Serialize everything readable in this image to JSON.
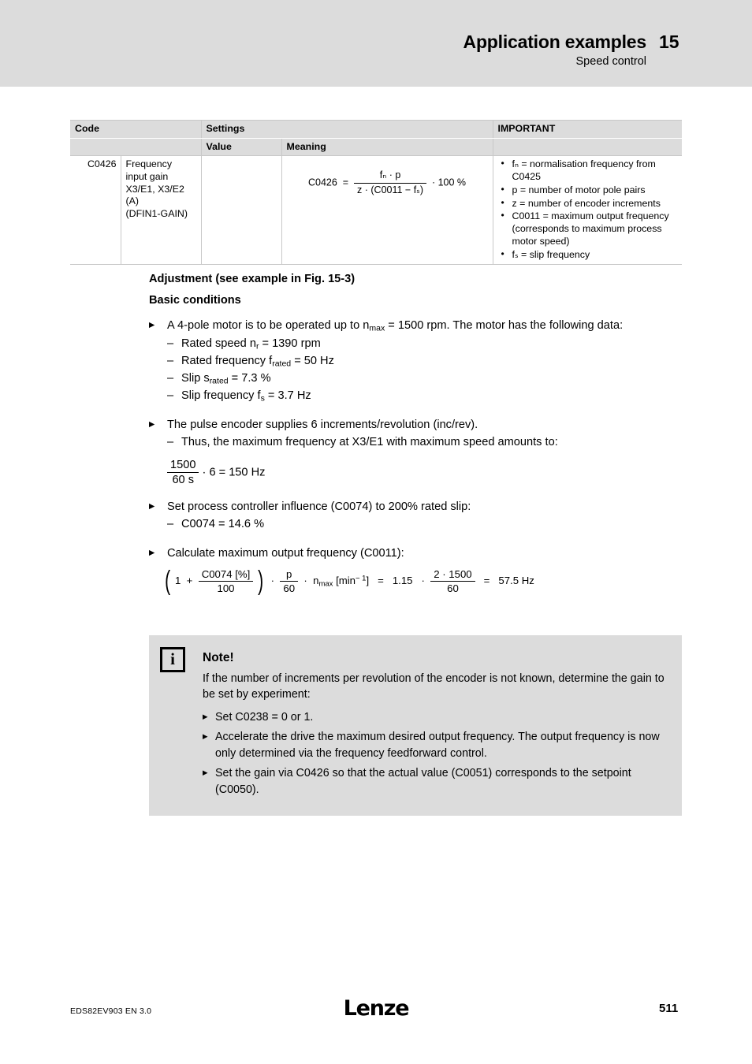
{
  "header": {
    "title": "Application examples",
    "subtitle": "Speed control",
    "chapter": "15"
  },
  "table": {
    "headers": {
      "code": "Code",
      "settings": "Settings",
      "important": "IMPORTANT",
      "value": "Value",
      "meaning": "Meaning"
    },
    "row": {
      "code": "C0426",
      "description": "Frequency input gain X3/E1, X3/E2 (A) (DFIN1-GAIN)",
      "value": "",
      "meaning_formula": {
        "lhs": "C0426",
        "eq": "=",
        "numerator": "fₙ · p",
        "denominator": "z · (C0011 − fₛ)",
        "tail": "· 100 %"
      },
      "important": [
        "fₙ = normalisation frequency from C0425",
        "p = number of motor pole pairs",
        "z = number of encoder increments",
        "C0011 = maximum output frequency (corresponds to maximum process motor speed)",
        "fₛ = slip frequency"
      ]
    }
  },
  "body": {
    "adjustment_heading": "Adjustment (see example in Fig. 15-3)",
    "basic_heading": "Basic conditions",
    "bullet1": "A 4-pole motor is to be operated up to n",
    "bullet1_sub": "max",
    "bullet1_cont": " = 1500 rpm. The motor has the following data:",
    "motor_data": [
      "Rated speed n",
      "Rated frequency f",
      "Slip s",
      "Slip frequency f"
    ],
    "motor_data_full": {
      "rated_speed_label": "Rated speed n",
      "rated_speed_sub": "r",
      "rated_speed_value": " = 1390 rpm",
      "rated_freq_label": "Rated frequency f",
      "rated_freq_sub": "rated",
      "rated_freq_value": " = 50 Hz",
      "slip_label": "Slip s",
      "slip_sub": "rated",
      "slip_value": " = 7.3 %",
      "slip_freq_label": "Slip frequency f",
      "slip_freq_sub": "s",
      "slip_freq_value": " = 3.7 Hz"
    },
    "bullet2": "The pulse encoder supplies 6 increments/revolution (inc/rev).",
    "bullet2_dash": "Thus, the maximum frequency at X3/E1 with maximum speed amounts to:",
    "eq_freq": {
      "numerator": "1500",
      "denominator": "60 s",
      "rest": "· 6  =  150 Hz"
    },
    "bullet3": "Set process controller influence (C0074) to 200% rated slip:",
    "bullet3_dash": "C0074 = 14.6 %",
    "bullet4": "Calculate maximum output frequency (C0011):",
    "eq_c0011": {
      "one": "1",
      "plus": "+",
      "num1": "C0074 [%]",
      "den1": "100",
      "dot1": "·",
      "num2": "p",
      "den2": "60",
      "dot2": "·",
      "nmax": "n",
      "nmax_sub": "max",
      "unit": "[min",
      "unit_sup": "− 1",
      "unit_close": "]",
      "eq1": "=",
      "factor": "1.15",
      "dot3": "·",
      "num3": "2  ·  1500",
      "den3": "60",
      "eq2": "=",
      "result": "57.5 Hz"
    }
  },
  "note": {
    "icon": "i",
    "title": "Note!",
    "paragraph": "If the number of increments per revolution of the encoder is not known, determine the gain to be set by experiment:",
    "items": [
      "Set C0238 = 0 or 1.",
      "Accelerate the drive the maximum desired output frequency. The output frequency is now only determined via the frequency feedforward control.",
      "Set the gain via C0426 so that the actual value (C0051) corresponds to the setpoint (C0050)."
    ]
  },
  "footer": {
    "document": "EDS82EV903  EN  3.0",
    "logo": "Lenze",
    "page": "511"
  },
  "colors": {
    "header_band": "#dcdcdc",
    "note_bg": "#dcdcdc",
    "table_border": "#c8c8c8",
    "text": "#000000"
  }
}
